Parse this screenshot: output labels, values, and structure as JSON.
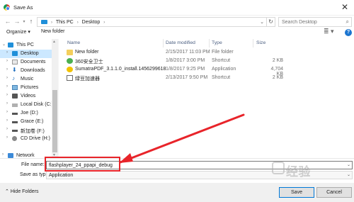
{
  "window": {
    "title": "Save As",
    "close": "✕"
  },
  "address": {
    "crumbs": [
      "This PC",
      "Desktop"
    ],
    "search_placeholder": "Search Desktop"
  },
  "toolbar": {
    "organize": "Organize ▾",
    "new_folder": "New folder"
  },
  "nav": {
    "items": [
      {
        "label": "This PC"
      },
      {
        "label": "Desktop"
      },
      {
        "label": "Documents"
      },
      {
        "label": "Downloads"
      },
      {
        "label": "Music"
      },
      {
        "label": "Pictures"
      },
      {
        "label": "Videos"
      },
      {
        "label": "Local Disk (C:)"
      },
      {
        "label": "Joe (D:)"
      },
      {
        "label": "Grace (E:)"
      },
      {
        "label": "新加卷 (F:)"
      },
      {
        "label": "CD Drive (H:)"
      },
      {
        "label": "Network"
      }
    ]
  },
  "columns": {
    "name": "Name",
    "date": "Date modified",
    "type": "Type",
    "size": "Size"
  },
  "files": [
    {
      "name": "New folder",
      "date": "2/15/2017 11:03 PM",
      "type": "File folder",
      "size": ""
    },
    {
      "name": "360安全卫士",
      "date": "1/8/2017 3:00 PM",
      "type": "Shortcut",
      "size": "2 KB"
    },
    {
      "name": "SumatraPDF_3.1.1.0_install.1456299618",
      "date": "1/8/2017 9:25 PM",
      "type": "Application",
      "size": "4,704 KB"
    },
    {
      "name": "绿豆加速器",
      "date": "2/13/2017 9:50 PM",
      "type": "Shortcut",
      "size": "2 KB"
    }
  ],
  "form": {
    "file_name_label": "File name:",
    "file_name_value": "flashplayer_24_ppapi_debug",
    "save_type_label": "Save as type:",
    "save_type_value": "Application"
  },
  "footer": {
    "hide_folders": "Hide Folders",
    "save": "Save",
    "cancel": "Cancel"
  },
  "watermark": "经验",
  "colors": {
    "selection": "#cce8ff",
    "annotation": "#e8242a",
    "accent": "#0078d7"
  }
}
